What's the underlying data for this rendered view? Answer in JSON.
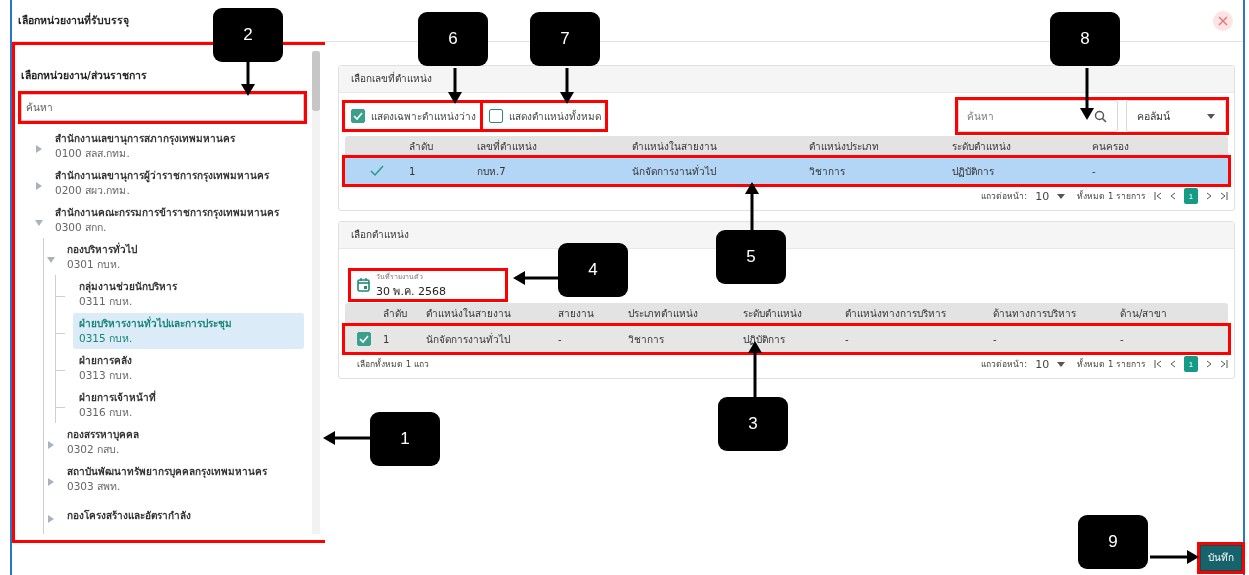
{
  "dialog": {
    "title": "เลือกหน่วยงานที่รับบรรจุ"
  },
  "unit_panel": {
    "title": "เลือกหน่วยงาน/ส่วนราชการ",
    "search": {
      "placeholder": "ค้นหา"
    },
    "tree": [
      {
        "kind": "group",
        "name": "สำนักงานเลขานุการสภากรุงเทพมหานคร",
        "code": "0100 สลส.กทม.",
        "expanded": false,
        "selected": false
      },
      {
        "kind": "group",
        "name": "สำนักงานเลขานุการผู้ว่าราชการกรุงเทพมหานคร",
        "code": "0200 สผว.กทม.",
        "expanded": false,
        "selected": false
      },
      {
        "kind": "group",
        "name": "สำนักงานคณะกรรมการข้าราชการกรุงเทพมหานคร",
        "code": "0300 สกก.",
        "expanded": true,
        "selected": false,
        "children": [
          {
            "kind": "group",
            "name": "กองบริหารทั่วไป",
            "code": "0301 กบห.",
            "expanded": true,
            "selected": false,
            "children": [
              {
                "kind": "leaf",
                "name": "กลุ่มงานช่วยนักบริหาร",
                "code": "0311 กบห.",
                "selected": false
              },
              {
                "kind": "leaf",
                "name": "ฝ่ายบริหารงานทั่วไปและการประชุม",
                "code": "0315 กบห.",
                "selected": true
              },
              {
                "kind": "leaf",
                "name": "ฝ่ายการคลัง",
                "code": "0313 กบห.",
                "selected": false
              },
              {
                "kind": "leaf",
                "name": "ฝ่ายการเจ้าหน้าที่",
                "code": "0316 กบห.",
                "selected": false
              }
            ]
          },
          {
            "kind": "group",
            "name": "กองสรรหาบุคคล",
            "code": "0302 กสบ.",
            "expanded": false,
            "selected": false
          },
          {
            "kind": "group",
            "name": "สถาบันพัฒนาทรัพยากรบุคคลกรุงเทพมหานคร",
            "code": "0303 สพท.",
            "expanded": false,
            "selected": false
          },
          {
            "kind": "group",
            "name": "กองโครงสร้างและอัตรากำลัง",
            "expanded": false,
            "selected": false
          }
        ]
      }
    ]
  },
  "position_number_card": {
    "title": "เลือกเลขที่ตำแหน่ง",
    "filters": [
      {
        "label": "แสดงเฉพาะตำแหน่งว่าง",
        "checked": true
      },
      {
        "label": "แสดงตำแหน่งทั้งหมด",
        "checked": false
      }
    ],
    "search": {
      "placeholder": "ค้นหา"
    },
    "column_select": {
      "value": "คอลัมน์"
    },
    "table": {
      "columns": [
        "ลำดับ",
        "เลขที่ตำแหน่ง",
        "ตำแหน่งในสายงาน",
        "ตำแหน่งประเภท",
        "ระดับตำแหน่ง",
        "คนครอง"
      ],
      "rows": [
        {
          "selected": true,
          "cells": [
            "1",
            "กบห.7",
            "นักจัดการงานทั่วไป",
            "วิชาการ",
            "ปฏิบัติการ",
            "-"
          ]
        }
      ]
    },
    "pagination": {
      "rows_per_page_label": "แถวต่อหน้า:",
      "rows_per_page": "10",
      "total": "ทั้งหมด 1 รายการ",
      "pages": [
        {
          "label": "1",
          "selected": true
        }
      ]
    }
  },
  "position_card": {
    "title": "เลือกตำแหน่ง",
    "report_date": {
      "label": "วันที่รายงานตัว",
      "value": "30 พ.ค. 2568"
    },
    "table": {
      "columns": [
        "ลำดับ",
        "ตำแหน่งในสายงาน",
        "สายงาน",
        "ประเภทตำแหน่ง",
        "ระดับตำแหน่ง",
        "ตำแหน่งทางการบริหาร",
        "ด้านทางการบริหาร",
        "ด้าน/สาขา"
      ],
      "rows": [
        {
          "checked": true,
          "cells": [
            "1",
            "นักจัดการงานทั่วไป",
            "-",
            "วิชาการ",
            "ปฏิบัติการ",
            "-",
            "-",
            "-"
          ]
        }
      ]
    },
    "selection_summary": "เลือกทั้งหมด 1 แถว",
    "pagination": {
      "rows_per_page_label": "แถวต่อหน้า:",
      "rows_per_page": "10",
      "total": "ทั้งหมด 1 รายการ",
      "pages": [
        {
          "label": "1",
          "selected": true
        }
      ]
    }
  },
  "save_button": "บันทึก",
  "callouts": [
    {
      "label": "1"
    },
    {
      "label": "2"
    },
    {
      "label": "3"
    },
    {
      "label": "4"
    },
    {
      "label": "5"
    },
    {
      "label": "6"
    },
    {
      "label": "7"
    },
    {
      "label": "8"
    },
    {
      "label": "9"
    }
  ]
}
